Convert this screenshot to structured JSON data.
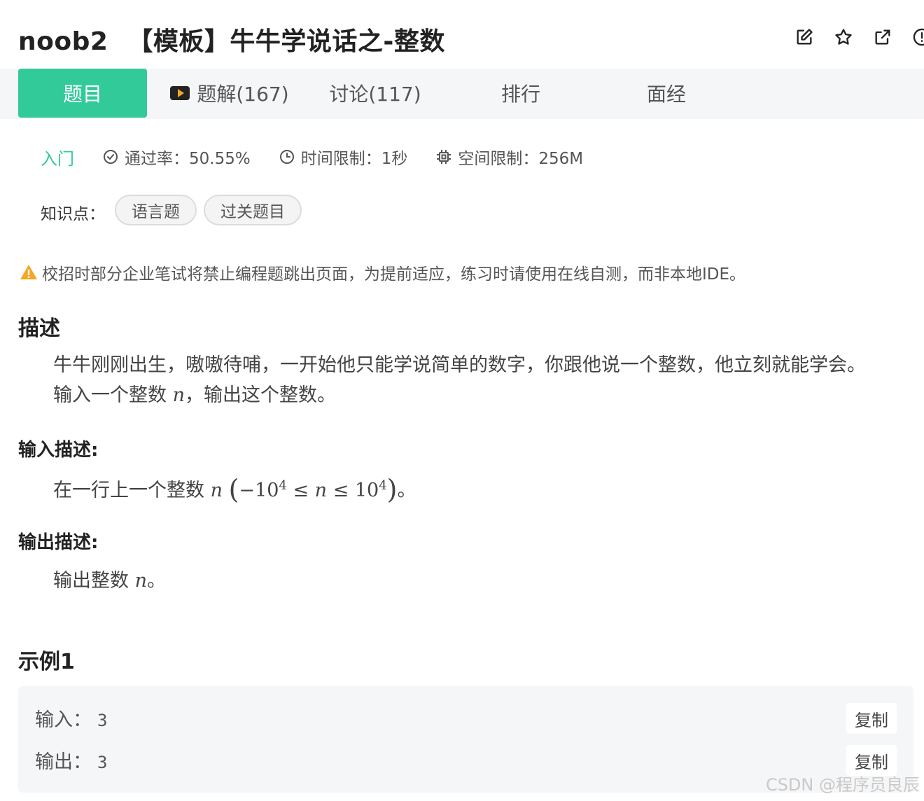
{
  "header": {
    "problem_id": "noob2",
    "problem_title": "【模板】牛牛学说话之-整数"
  },
  "tabs": [
    {
      "label": "题目",
      "active": true
    },
    {
      "label": "题解(167)",
      "icon": "video-icon"
    },
    {
      "label": "讨论(117)"
    },
    {
      "label": "排行"
    },
    {
      "label": "面经"
    }
  ],
  "meta": {
    "difficulty": "入门",
    "pass_rate": "通过率：50.55%",
    "time_limit": "时间限制：1秒",
    "space_limit": "空间限制：256M"
  },
  "knowledge": {
    "label": "知识点：",
    "tags": [
      "语言题",
      "过关题目"
    ]
  },
  "notice": "校招时部分企业笔试将禁止编程题跳出页面，为提前适应，练习时请使用在线自测，而非本地IDE。",
  "description": {
    "heading": "描述",
    "line1": "牛牛刚刚出生，嗷嗷待哺，一开始他只能学说简单的数字，你跟他说一个整数，他立刻就能学会。",
    "line2_prefix": "输入一个整数 ",
    "line2_var": "n",
    "line2_suffix": "，输出这个整数。"
  },
  "input_desc": {
    "heading": "输入描述:",
    "prefix": "在一行上一个整数 ",
    "var": "n",
    "lparen": "(",
    "minus": "−10",
    "exp1": "4",
    "le1": " ≤ ",
    "var2": "n",
    "le2": " ≤ 10",
    "exp2": "4",
    "rparen": ")",
    "suffix": "。"
  },
  "output_desc": {
    "heading": "输出描述:",
    "prefix": "输出整数 ",
    "var": "n",
    "suffix": "。"
  },
  "example": {
    "heading": "示例1",
    "input_label": "输入：",
    "input_value": "3",
    "output_label": "输出：",
    "output_value": "3",
    "copy_label": "复制"
  },
  "watermark": "CSDN @程序员良辰",
  "colors": {
    "accent": "#32ca99",
    "warning": "#f5a623"
  }
}
